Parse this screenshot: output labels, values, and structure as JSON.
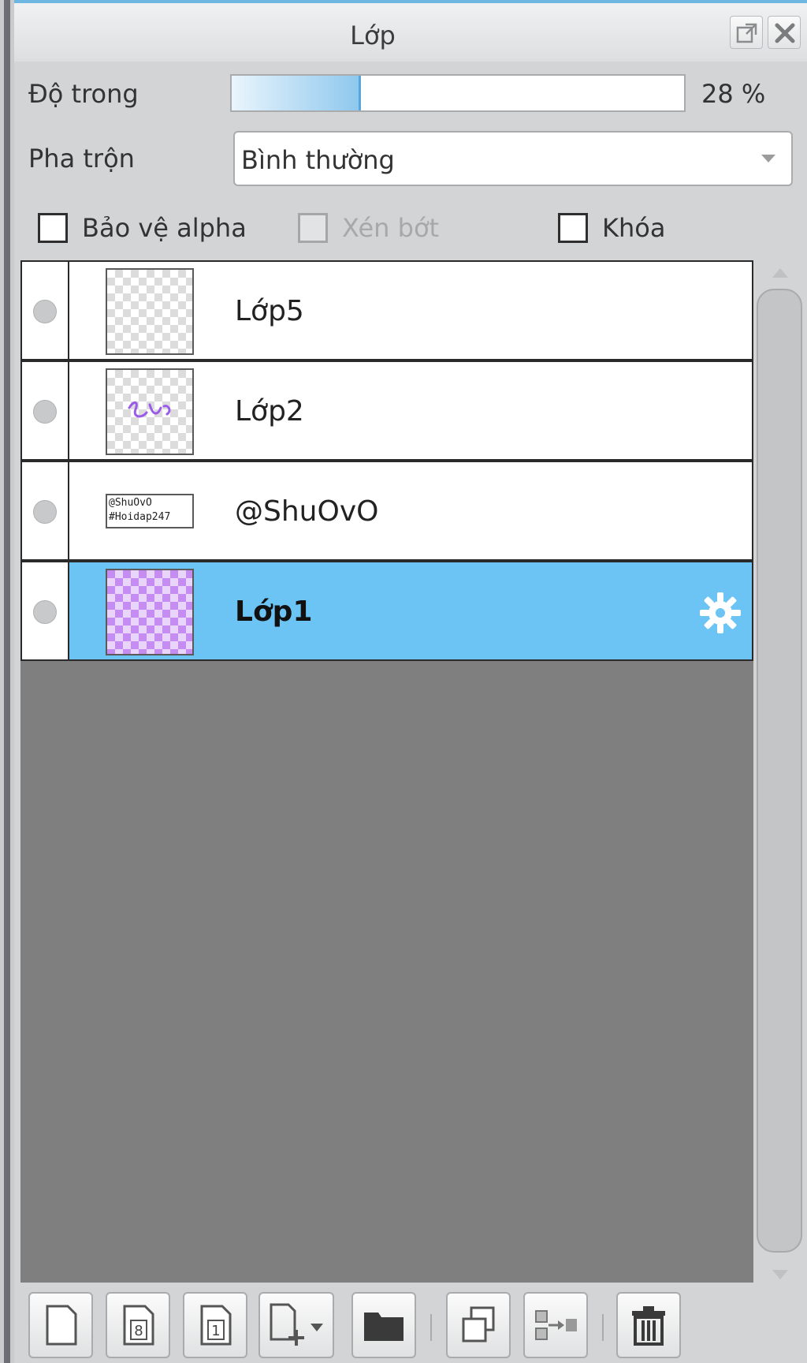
{
  "panel": {
    "title": "Lớp"
  },
  "titlebar_buttons": {
    "float_icon": "open-external-icon",
    "close_icon": "close-icon"
  },
  "opacity": {
    "label": "Độ trong",
    "value": 28,
    "display": "28 %",
    "fill_color": "#8fc8ee"
  },
  "blend": {
    "label": "Pha trộn",
    "selected": "Bình thường"
  },
  "options": {
    "protect_alpha": {
      "label": "Bảo vệ alpha",
      "checked": false,
      "enabled": true
    },
    "clipping": {
      "label": "Xén bớt",
      "checked": false,
      "enabled": false
    },
    "lock": {
      "label": "Khóa",
      "checked": false,
      "enabled": true
    }
  },
  "layers": [
    {
      "name": "Lớp5",
      "thumbnail": "transparent",
      "selected": false
    },
    {
      "name": "Lớp2",
      "thumbnail": "purple-sketch",
      "selected": false
    },
    {
      "name": "@ShuOvO",
      "thumbnail": "text-layer",
      "thumb_lines": [
        "@ShuOvO",
        "#Hoidap247"
      ],
      "selected": false
    },
    {
      "name": "Lớp1",
      "thumbnail": "purple-checker",
      "selected": true,
      "settings_icon": "gear-icon"
    }
  ],
  "colors": {
    "selected_row": "#6cc4f5",
    "accent": "#6eb6e2",
    "layer_area_bg": "#7f7f7f"
  },
  "toolbar": [
    "new-layer-icon",
    "new-8bit-layer-icon",
    "new-1bit-layer-icon",
    "add-layer-menu-icon",
    "new-folder-icon",
    "duplicate-layer-icon",
    "merge-layer-icon",
    "delete-layer-icon"
  ]
}
